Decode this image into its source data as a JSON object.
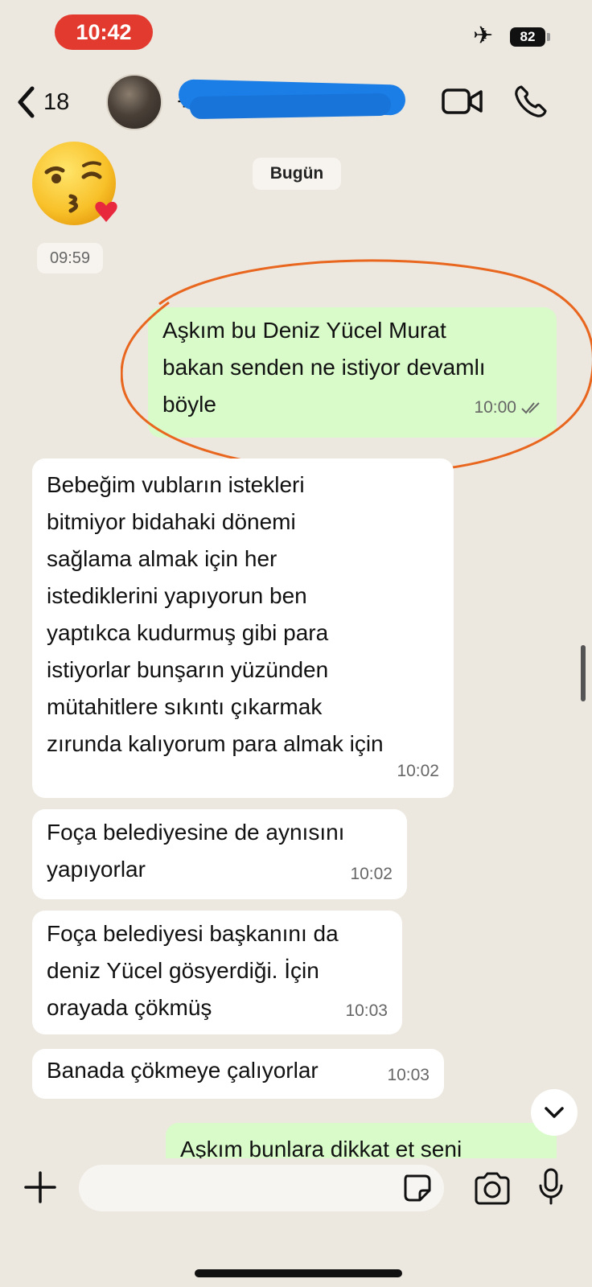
{
  "status_bar": {
    "time": "10:42",
    "battery": "82",
    "airplane_icon": "airplane-icon"
  },
  "header": {
    "back_count": "18",
    "contact_name": "+",
    "icons": [
      "chevron-left-icon",
      "video-call-icon",
      "phone-icon"
    ]
  },
  "date_chip": "Bugün",
  "messages": [
    {
      "direction": "incoming",
      "type": "emoji",
      "content": "😘",
      "time": "09:59"
    },
    {
      "direction": "outgoing",
      "lines": [
        "Aşkım bu Deniz Yücel Murat",
        "bakan senden ne istiyor devamlı",
        "böyle"
      ],
      "time": "10:00",
      "status": "read"
    },
    {
      "direction": "incoming",
      "lines": [
        "Bebeğim vubların istekleri",
        "bitmiyor bidahaki dönemi",
        "sağlama almak için her",
        "istediklerini yapıyorun ben",
        "yaptıkca kudurmuş gibi para",
        "istiyorlar bunşarın yüzünden",
        "mütahitlere sıkıntı çıkarmak",
        "zırunda kalıyorum para almak için"
      ],
      "time": "10:02"
    },
    {
      "direction": "incoming",
      "lines": [
        "Foça belediyesine de aynısını",
        "yapıyorlar"
      ],
      "time": "10:02"
    },
    {
      "direction": "incoming",
      "lines": [
        "Foça belediyesi başkanını da",
        "deniz Yücel gösyerdiği. İçin",
        "orayada çökmüş"
      ],
      "time": "10:03"
    },
    {
      "direction": "incoming",
      "lines": [
        "Banada çökmeye çalıyorlar"
      ],
      "time": "10:03"
    },
    {
      "direction": "outgoing",
      "lines": [
        "Aşkım bunlara dikkat et seni"
      ],
      "time": ""
    }
  ],
  "input": {
    "placeholder": "",
    "icons": [
      "plus-icon",
      "sticker-icon",
      "camera-icon",
      "microphone-icon"
    ]
  },
  "colors": {
    "background": "#ece7df",
    "outgoing_bubble": "#d8fbc9",
    "incoming_bubble": "#ffffff",
    "time_pill": "#e33a2f",
    "annotation_circle": "#e8661e",
    "redaction": "#1a7ee6"
  }
}
